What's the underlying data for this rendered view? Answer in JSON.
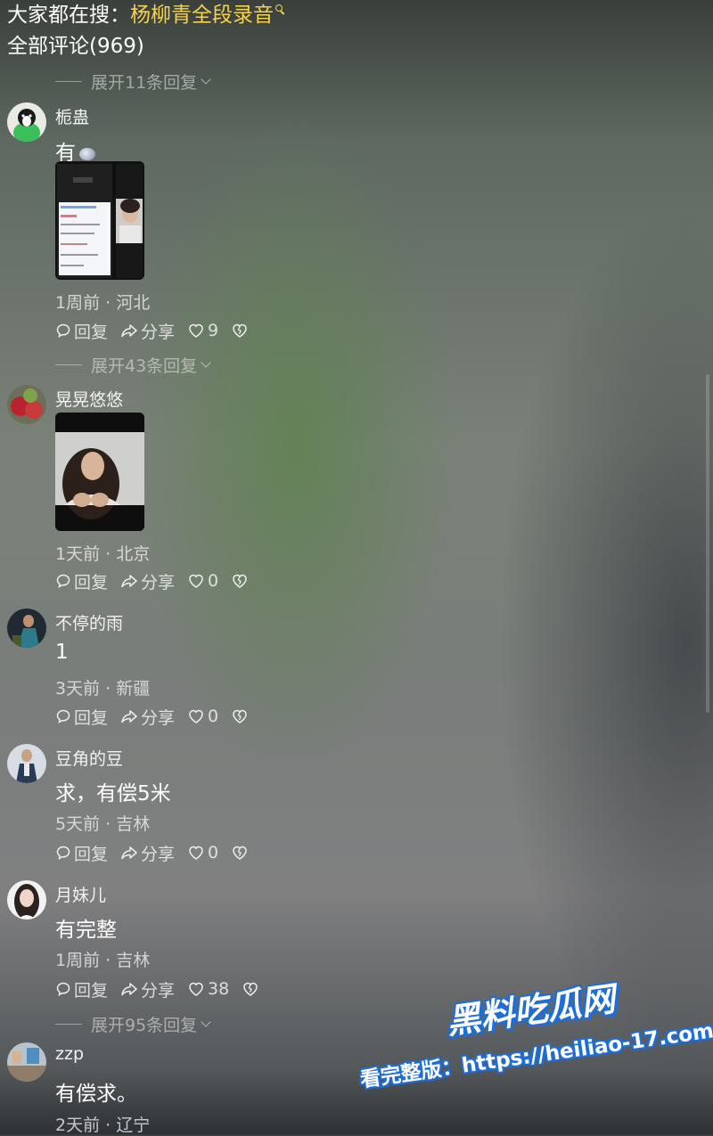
{
  "header": {
    "search_label": "大家都在搜：",
    "search_query": "杨柳青全段录音",
    "comment_count_label": "全部评论(969)"
  },
  "expand_labels": [
    "展开11条回复",
    "展开43条回复",
    "展开95条回复"
  ],
  "action_labels": {
    "reply": "回复",
    "share": "分享"
  },
  "comments": [
    {
      "username": "栀蛊",
      "content": "有",
      "time": "1周前",
      "location": "河北",
      "likes": "9",
      "has_image": true,
      "has_emoji": true
    },
    {
      "username": "晃晃悠悠",
      "content": "",
      "time": "1天前",
      "location": "北京",
      "likes": "0",
      "has_image": true,
      "has_emoji": false
    },
    {
      "username": "不停的雨",
      "content": "1",
      "time": "3天前",
      "location": "新疆",
      "likes": "0",
      "has_image": false,
      "has_emoji": false
    },
    {
      "username": "豆角的豆",
      "content": "求，有偿5米",
      "time": "5天前",
      "location": "吉林",
      "likes": "0",
      "has_image": false,
      "has_emoji": false
    },
    {
      "username": "月妹儿",
      "content": "有完整",
      "time": "1周前",
      "location": "吉林",
      "likes": "38",
      "has_image": false,
      "has_emoji": false
    },
    {
      "username": "zzp",
      "content": "有偿求。",
      "time": "2天前",
      "location": "辽宁",
      "likes": "",
      "has_image": false,
      "has_emoji": false
    }
  ],
  "meta_separator": "·",
  "watermark": {
    "brand": "黑料吃瓜网",
    "url_text": "看完整版：https://heiliao-17.com"
  },
  "colors": {
    "search_query": "#f5d24a",
    "watermark_outline": "#1d6ed8"
  }
}
